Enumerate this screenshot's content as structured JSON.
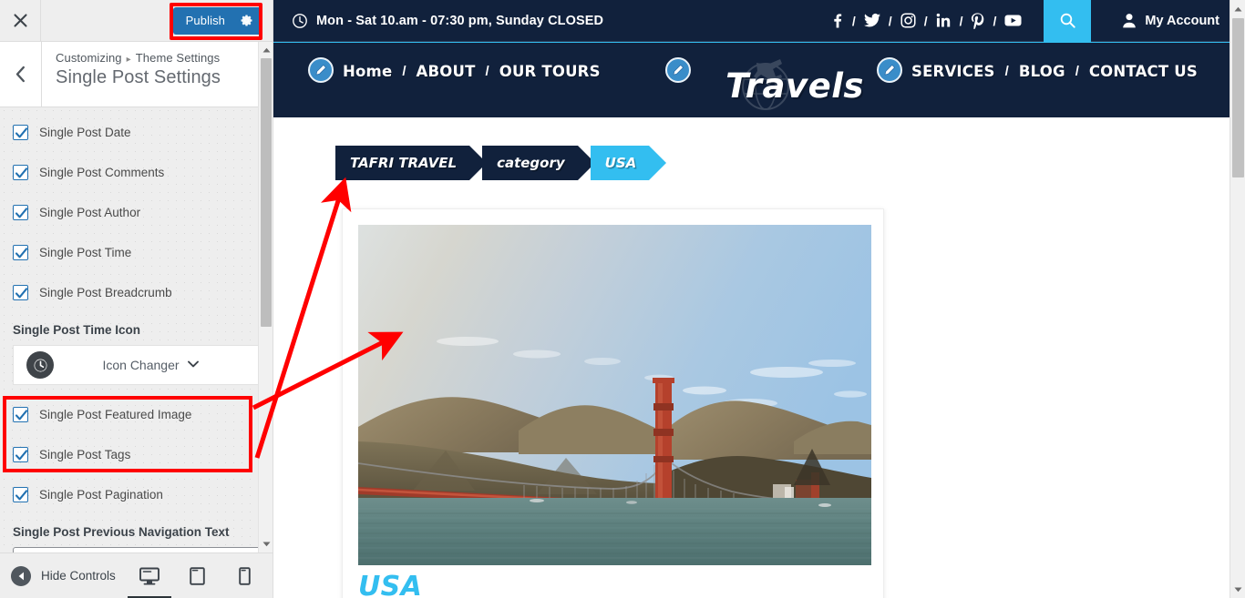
{
  "customizer": {
    "close_label": "Close",
    "publish_label": "Publish",
    "gear_label": "Publish settings",
    "back_label": "Back",
    "breadcrumb_root": "Customizing",
    "breadcrumb_sep": "▸",
    "breadcrumb_parent": "Theme Settings",
    "panel_title": "Single Post Settings",
    "checkboxes": [
      {
        "label": "Single Post Date",
        "checked": true
      },
      {
        "label": "Single Post Comments",
        "checked": true
      },
      {
        "label": "Single Post Author",
        "checked": true
      },
      {
        "label": "Single Post Time",
        "checked": true
      },
      {
        "label": "Single Post Breadcrumb",
        "checked": true
      }
    ],
    "time_icon_label": "Single Post Time Icon",
    "icon_changer_label": "Icon Changer",
    "icon_changer_icon": "clock-icon",
    "highlighted_checkboxes": [
      {
        "label": "Single Post Featured Image",
        "checked": true
      },
      {
        "label": "Single Post Tags",
        "checked": true
      }
    ],
    "pagination_checkbox": {
      "label": "Single Post Pagination",
      "checked": true
    },
    "prev_nav_label": "Single Post Previous Navigation Text",
    "prev_nav_value": "",
    "prev_nav_placeholder": "",
    "footer": {
      "hide_controls_label": "Hide Controls",
      "devices": [
        {
          "name": "desktop",
          "active": true
        },
        {
          "name": "tablet",
          "active": false
        },
        {
          "name": "mobile",
          "active": false
        }
      ]
    }
  },
  "annotations": {
    "highlight_color": "#ff0000",
    "arrow_color": "#ff0000",
    "boxes": [
      "publish-button",
      "featured-image-and-tags-checkboxes"
    ],
    "arrow_targets": [
      "breadcrumb",
      "featured-image"
    ]
  },
  "preview": {
    "topbar": {
      "hours": "Mon - Sat 10.am - 07:30 pm, Sunday CLOSED",
      "clock_icon": "clock-icon",
      "socials": [
        {
          "name": "facebook-icon",
          "glyph": "f"
        },
        {
          "name": "twitter-icon",
          "glyph": "t"
        },
        {
          "name": "instagram-icon",
          "glyph": "i"
        },
        {
          "name": "linkedin-icon",
          "glyph": "in"
        },
        {
          "name": "pinterest-icon",
          "glyph": "p"
        },
        {
          "name": "youtube-icon",
          "glyph": "y"
        }
      ],
      "social_separator": "/",
      "search_icon": "search-icon",
      "account_label": "My Account",
      "account_icon": "user-icon",
      "bg_color": "#11213c",
      "accent_color": "#33bef0"
    },
    "nav": {
      "left_links": [
        "Home",
        "ABOUT",
        "OUR TOURS"
      ],
      "right_links": [
        "SERVICES",
        "BLOG",
        "CONTACT US"
      ],
      "separator": "/",
      "brand": "Travels",
      "brand_icon": "airplane-globe-icon",
      "edit_icon": "pencil-edit-icon"
    },
    "breadcrumbs": [
      {
        "label": "TAFRI TRAVEL",
        "style": "dark"
      },
      {
        "label": "category",
        "style": "dark"
      },
      {
        "label": "USA",
        "style": "light"
      }
    ],
    "post": {
      "title": "USA",
      "featured_image_alt": "golden-gate-bridge-photo",
      "title_color": "#33bef0"
    }
  }
}
